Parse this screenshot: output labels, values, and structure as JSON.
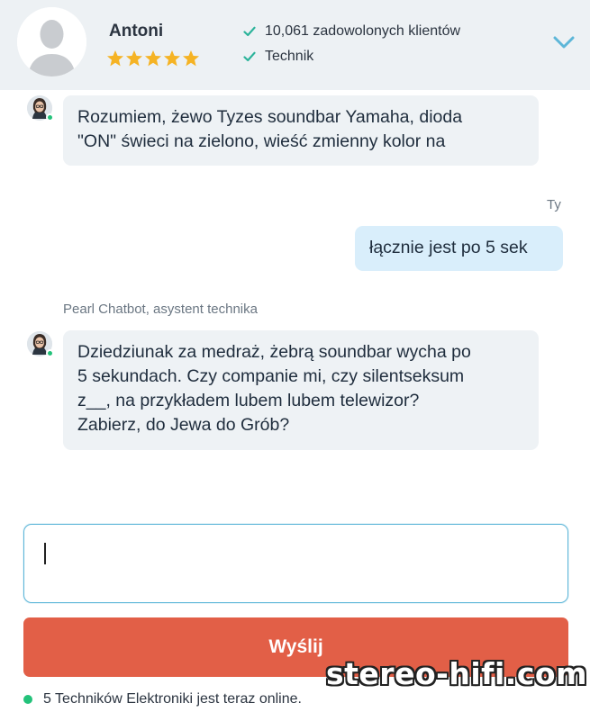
{
  "header": {
    "expert_name": "Antoni",
    "rating_stars": 5,
    "badges": [
      "10,061 zadowolonych klientów",
      "Technik"
    ],
    "colors": {
      "background": "#edf1f4",
      "star": "#f5b324",
      "check": "#2bb39a",
      "chevron": "#5db6d8"
    }
  },
  "chat": {
    "messages": [
      {
        "sender": "bot",
        "text_lines": [
          "Rozumiem, żewo Tyzes soundbar Yamaha, dioda",
          "\"ON\" świeci na zielono, wieść zmienny kolor na"
        ]
      },
      {
        "sender": "user",
        "label": "Ty",
        "text": "łącznie jest po 5 sek"
      },
      {
        "sender": "bot",
        "label": "Pearl Chatbot, asystent technika",
        "text_lines": [
          "Dziedziunak za medraż, żebrą soundbar wycha po",
          "5 sekundach. Czy companie mi, czy silentseksum",
          "z__, na przykładem lubem lubem telewizor?",
          "Zabierz, do Jewa do Grób?"
        ]
      }
    ]
  },
  "input": {
    "value": ""
  },
  "send_button": {
    "label": "Wyślij",
    "color": "#e25f47"
  },
  "status": {
    "online_text": "5 Techników Elektroniki jest teraz online.",
    "online_color": "#23c27a"
  },
  "watermark": "stereo-hifi.com"
}
